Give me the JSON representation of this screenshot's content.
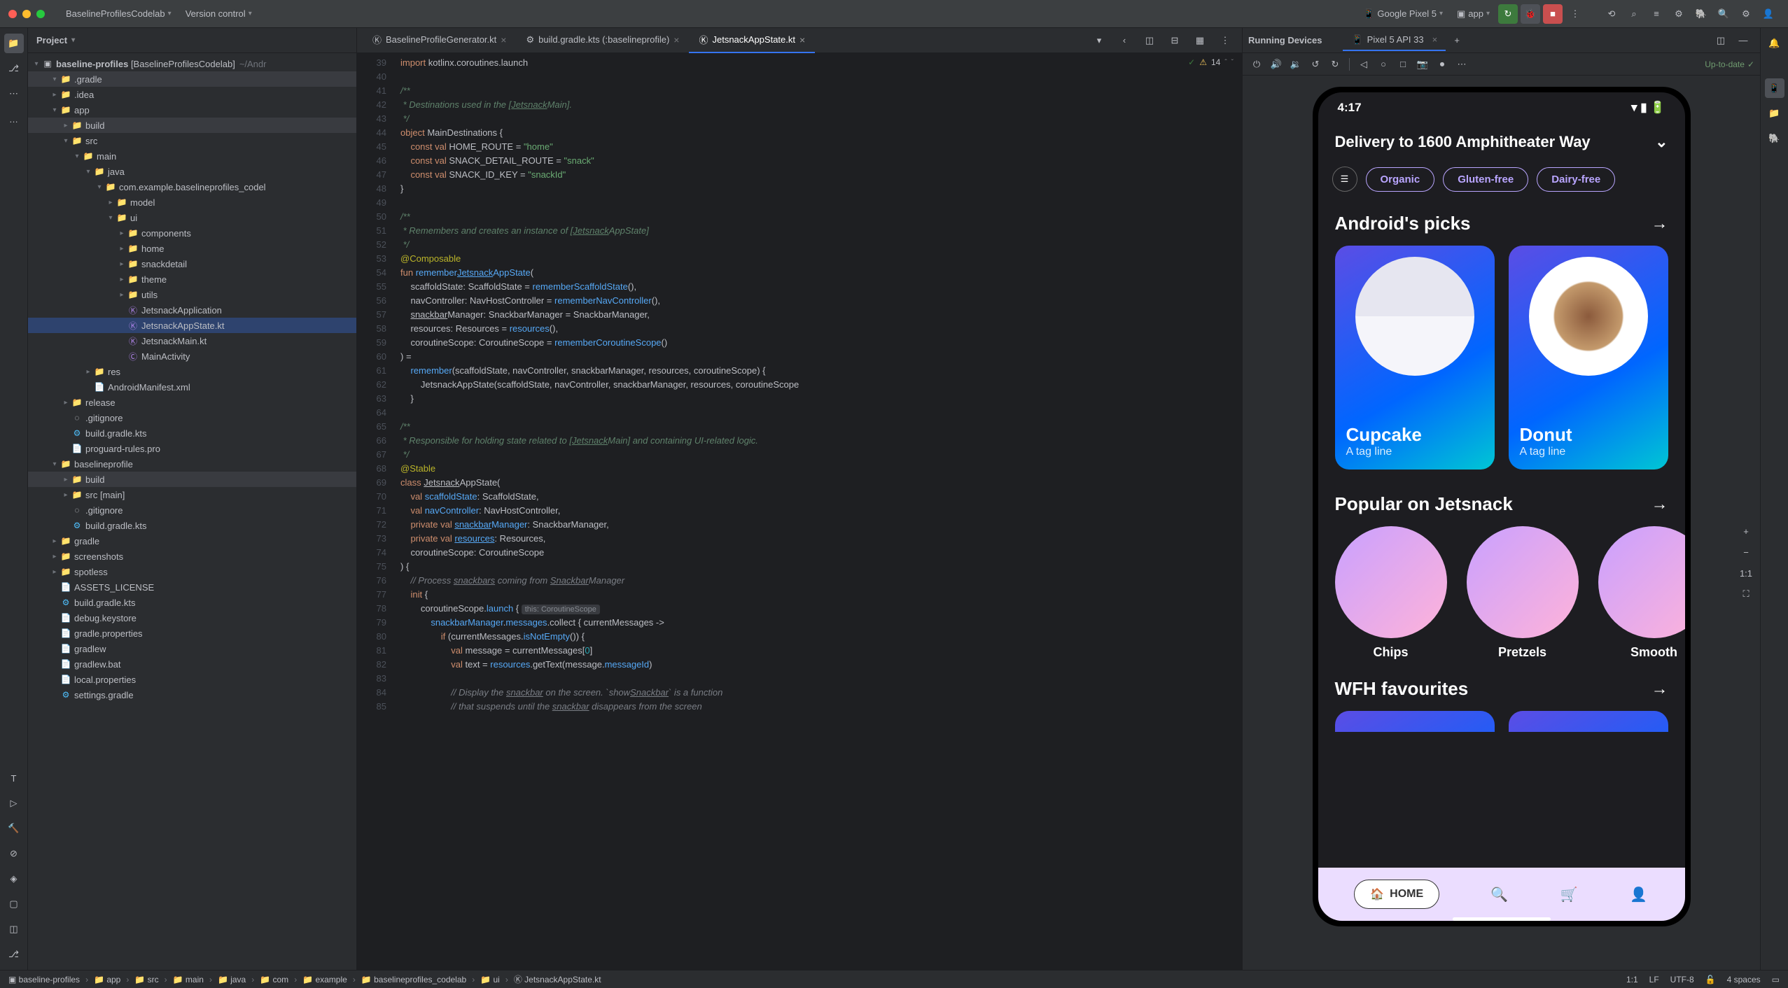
{
  "titlebar": {
    "project": "BaselineProfilesCodelab",
    "vcs": "Version control",
    "device": "Google Pixel 5",
    "run_config": "app"
  },
  "project_panel": {
    "title": "Project",
    "root": "baseline-profiles",
    "root_hint": "[BaselineProfilesCodelab]",
    "root_path": "~/Andr",
    "tree": [
      {
        "d": 1,
        "arrow": "v",
        "icon": "📁",
        "label": ".gradle",
        "cls": "highlight"
      },
      {
        "d": 1,
        "arrow": ">",
        "icon": "📁",
        "label": ".idea"
      },
      {
        "d": 1,
        "arrow": "v",
        "icon": "📁",
        "label": "app"
      },
      {
        "d": 2,
        "arrow": ">",
        "icon": "📁",
        "label": "build",
        "cls": "highlight"
      },
      {
        "d": 2,
        "arrow": "v",
        "icon": "📁",
        "label": "src"
      },
      {
        "d": 3,
        "arrow": "v",
        "icon": "📁",
        "label": "main"
      },
      {
        "d": 4,
        "arrow": "v",
        "icon": "📁",
        "label": "java"
      },
      {
        "d": 5,
        "arrow": "v",
        "icon": "📁",
        "label": "com.example.baselineprofiles_codel"
      },
      {
        "d": 6,
        "arrow": ">",
        "icon": "📁",
        "label": "model"
      },
      {
        "d": 6,
        "arrow": "v",
        "icon": "📁",
        "label": "ui"
      },
      {
        "d": 7,
        "arrow": ">",
        "icon": "📁",
        "label": "components"
      },
      {
        "d": 7,
        "arrow": ">",
        "icon": "📁",
        "label": "home"
      },
      {
        "d": 7,
        "arrow": ">",
        "icon": "📁",
        "label": "snackdetail"
      },
      {
        "d": 7,
        "arrow": ">",
        "icon": "📁",
        "label": "theme"
      },
      {
        "d": 7,
        "arrow": ">",
        "icon": "📁",
        "label": "utils"
      },
      {
        "d": 7,
        "arrow": "",
        "icon": "Ⓚ",
        "label": "JetsnackApplication",
        "iconCls": "kt-icon"
      },
      {
        "d": 7,
        "arrow": "",
        "icon": "Ⓚ",
        "label": "JetsnackAppState.kt",
        "iconCls": "kt-icon",
        "cls": "selected"
      },
      {
        "d": 7,
        "arrow": "",
        "icon": "Ⓚ",
        "label": "JetsnackMain.kt",
        "iconCls": "kt-icon"
      },
      {
        "d": 7,
        "arrow": "",
        "icon": "Ⓒ",
        "label": "MainActivity",
        "iconCls": "kt-icon"
      },
      {
        "d": 4,
        "arrow": ">",
        "icon": "📁",
        "label": "res"
      },
      {
        "d": 4,
        "arrow": "",
        "icon": "📄",
        "label": "AndroidManifest.xml"
      },
      {
        "d": 2,
        "arrow": ">",
        "icon": "📁",
        "label": "release"
      },
      {
        "d": 2,
        "arrow": "",
        "icon": "◌",
        "label": ".gitignore"
      },
      {
        "d": 2,
        "arrow": "",
        "icon": "⚙",
        "label": "build.gradle.kts",
        "iconCls": "gradle-icon"
      },
      {
        "d": 2,
        "arrow": "",
        "icon": "📄",
        "label": "proguard-rules.pro"
      },
      {
        "d": 1,
        "arrow": "v",
        "icon": "📁",
        "label": "baselineprofile"
      },
      {
        "d": 2,
        "arrow": ">",
        "icon": "📁",
        "label": "build",
        "cls": "highlight"
      },
      {
        "d": 2,
        "arrow": ">",
        "icon": "📁",
        "label": "src [main]"
      },
      {
        "d": 2,
        "arrow": "",
        "icon": "◌",
        "label": ".gitignore"
      },
      {
        "d": 2,
        "arrow": "",
        "icon": "⚙",
        "label": "build.gradle.kts",
        "iconCls": "gradle-icon"
      },
      {
        "d": 1,
        "arrow": ">",
        "icon": "📁",
        "label": "gradle"
      },
      {
        "d": 1,
        "arrow": ">",
        "icon": "📁",
        "label": "screenshots"
      },
      {
        "d": 1,
        "arrow": ">",
        "icon": "📁",
        "label": "spotless"
      },
      {
        "d": 1,
        "arrow": "",
        "icon": "📄",
        "label": "ASSETS_LICENSE"
      },
      {
        "d": 1,
        "arrow": "",
        "icon": "⚙",
        "label": "build.gradle.kts",
        "iconCls": "gradle-icon"
      },
      {
        "d": 1,
        "arrow": "",
        "icon": "📄",
        "label": "debug.keystore"
      },
      {
        "d": 1,
        "arrow": "",
        "icon": "📄",
        "label": "gradle.properties"
      },
      {
        "d": 1,
        "arrow": "",
        "icon": "📄",
        "label": "gradlew"
      },
      {
        "d": 1,
        "arrow": "",
        "icon": "📄",
        "label": "gradlew.bat"
      },
      {
        "d": 1,
        "arrow": "",
        "icon": "📄",
        "label": "local.properties"
      },
      {
        "d": 1,
        "arrow": "",
        "icon": "⚙",
        "label": "settings.gradle",
        "iconCls": "gradle-icon"
      }
    ]
  },
  "editor": {
    "tabs": [
      {
        "icon": "Ⓚ",
        "label": "BaselineProfileGenerator.kt"
      },
      {
        "icon": "⚙",
        "label": "build.gradle.kts (:baselineprofile)"
      },
      {
        "icon": "Ⓚ",
        "label": "JetsnackAppState.kt",
        "active": true
      }
    ],
    "warnings": "14",
    "first_line": 39,
    "lines": [
      "<span class='kw'>import</span> kotlinx.coroutines.launch",
      "",
      "<span class='doc'>/**</span>",
      "<span class='doc'> * Destinations used in the [</span><span class='doc underline'>Jetsnack</span><span class='doc'>Main].</span>",
      "<span class='doc'> */</span>",
      "<span class='kw'>object</span> MainDestinations {",
      "    <span class='kw'>const val</span> HOME_ROUTE = <span class='str'>\"home\"</span>",
      "    <span class='kw'>const val</span> SNACK_DETAIL_ROUTE = <span class='str'>\"snack\"</span>",
      "    <span class='kw'>const val</span> SNACK_ID_KEY = <span class='str'>\"snackId\"</span>",
      "}",
      "",
      "<span class='doc'>/**</span>",
      "<span class='doc'> * Remembers and creates an instance of [</span><span class='doc underline'>Jetsnack</span><span class='doc'>AppState]</span>",
      "<span class='doc'> */</span>",
      "<span class='ann'>@Composable</span>",
      "<span class='kw'>fun</span> <span class='fn'>remember</span><span class='fn underline'>Jetsnack</span><span class='fn'>AppState</span>(",
      "    scaffoldState: ScaffoldState = <span class='fn'>rememberScaffoldState</span>(),",
      "    navController: NavHostController = <span class='fn'>rememberNavController</span>(),",
      "    <span class='underline'>snackbar</span>Manager: SnackbarManager = SnackbarManager,",
      "    resources: Resources = <span class='fn'>resources</span>(),",
      "    coroutineScope: CoroutineScope = <span class='fn'>rememberCoroutineScope</span>()",
      ") =",
      "    <span class='fn'>remember</span>(scaffoldState, navController, snackbarManager, resources, coroutineScope) {",
      "        JetsnackAppState(scaffoldState, navController, snackbarManager, resources, coroutineScope",
      "    }",
      "",
      "<span class='doc'>/**</span>",
      "<span class='doc'> * Responsible for holding state related to [</span><span class='doc underline'>Jetsnack</span><span class='doc'>Main] and containing UI-related logic.</span>",
      "<span class='doc'> */</span>",
      "<span class='ann'>@Stable</span>",
      "<span class='kw'>class</span> <span class='underline'>Jetsnack</span>AppState(",
      "    <span class='kw'>val</span> <span class='fn'>scaffoldState</span>: ScaffoldState,",
      "    <span class='kw'>val</span> <span class='fn'>navController</span>: NavHostController,",
      "    <span class='kw'>private val</span> <span class='fn underline'>snackbar</span><span class='fn'>Manager</span>: SnackbarManager,",
      "    <span class='kw'>private val</span> <span class='fn underline'>resources</span>: Resources,",
      "    coroutineScope: CoroutineScope",
      ") {",
      "    <span class='cmt'>// Process </span><span class='cmt underline'>snackbars</span><span class='cmt'> coming from </span><span class='cmt underline'>Snackbar</span><span class='cmt'>Manager</span>",
      "    <span class='kw'>init</span> {",
      "        coroutineScope.<span class='fn'>launch</span> { <span class='inlay'>this: CoroutineScope</span>",
      "            <span class='fn'>snackbarManager</span>.<span class='fn'>messages</span>.collect { currentMessages ->",
      "                <span class='kw'>if</span> (currentMessages.<span class='fn'>isNotEmpty</span>()) {",
      "                    <span class='kw'>val</span> message = currentMessages[<span class='num'>0</span>]",
      "                    <span class='kw'>val</span> text = <span class='fn'>resources</span>.getText(message.<span class='fn'>messageId</span>)",
      "",
      "                    <span class='cmt'>// Display the </span><span class='cmt underline'>snackbar</span><span class='cmt'> on the screen. `show</span><span class='cmt underline'>Snackbar</span><span class='cmt'>` is a function</span>",
      "                    <span class='cmt'>// that suspends until the </span><span class='cmt underline'>snackbar</span><span class='cmt'> disappears from the screen</span>"
    ]
  },
  "device": {
    "title": "Running Devices",
    "tab": "Pixel 5 API 33",
    "status": "Up-to-date",
    "screen": {
      "time": "4:17",
      "delivery": "Delivery to 1600 Amphitheater Way",
      "filters": [
        "Organic",
        "Gluten-free",
        "Dairy-free"
      ],
      "picks_title": "Android's picks",
      "cards": [
        {
          "name": "Cupcake",
          "tag": "A tag line"
        },
        {
          "name": "Donut",
          "tag": "A tag line"
        }
      ],
      "popular_title": "Popular on Jetsnack",
      "circles": [
        "Chips",
        "Pretzels",
        "Smooth"
      ],
      "wfh_title": "WFH favourites",
      "nav_home": "HOME"
    }
  },
  "breadcrumbs": [
    "baseline-profiles",
    "app",
    "src",
    "main",
    "java",
    "com",
    "example",
    "baselineprofiles_codelab",
    "ui",
    "JetsnackAppState.kt"
  ],
  "statusbar": {
    "pos": "1:1",
    "le": "LF",
    "enc": "UTF-8",
    "indent": "4 spaces"
  }
}
